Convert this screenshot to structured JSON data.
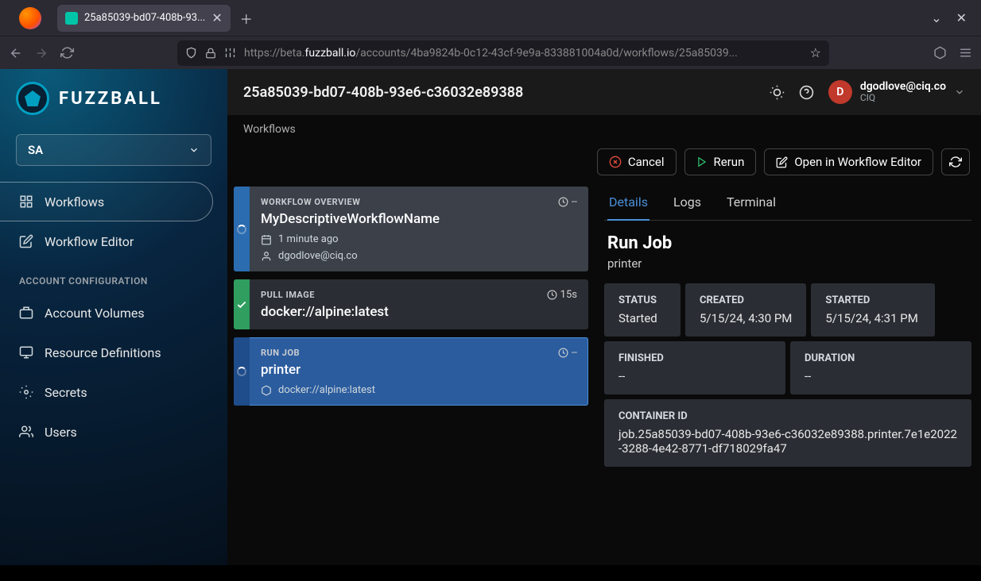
{
  "browser": {
    "tab_title": "25a85039-bd07-408b-93...",
    "url_prefix": "https://beta.",
    "url_host": "fuzzball.io",
    "url_path": "/accounts/4ba9824b-0c12-43cf-9e9a-833881004a0d/workflows/25a85039..."
  },
  "logo": {
    "text": "FUZZBALL"
  },
  "org_selector": {
    "value": "SA"
  },
  "sidebar": {
    "workflows": "Workflows",
    "workflow_editor": "Workflow Editor",
    "section": "ACCOUNT CONFIGURATION",
    "account_volumes": "Account Volumes",
    "resource_definitions": "Resource Definitions",
    "secrets": "Secrets",
    "users": "Users"
  },
  "topbar": {
    "title": "25a85039-bd07-408b-93e6-c36032e89388",
    "avatar_initial": "D",
    "user_email": "dgodlove@ciq.co",
    "user_org": "CIQ"
  },
  "breadcrumb": "Workflows",
  "actions": {
    "cancel": "Cancel",
    "rerun": "Rerun",
    "open_editor": "Open in Workflow Editor"
  },
  "steps": {
    "overview": {
      "label": "WORKFLOW OVERVIEW",
      "name": "MyDescriptiveWorkflowName",
      "time": "--",
      "ago": "1 minute ago",
      "user": "dgodlove@ciq.co"
    },
    "pull": {
      "label": "PULL IMAGE",
      "name": "docker://alpine:latest",
      "time": "15s"
    },
    "run": {
      "label": "RUN JOB",
      "name": "printer",
      "time": "--",
      "image": "docker://alpine:latest"
    }
  },
  "tabs": {
    "details": "Details",
    "logs": "Logs",
    "terminal": "Terminal"
  },
  "detail": {
    "title": "Run Job",
    "subtitle": "printer",
    "status_label": "STATUS",
    "status_value": "Started",
    "created_label": "CREATED",
    "created_value": "5/15/24, 4:30 PM",
    "started_label": "STARTED",
    "started_value": "5/15/24, 4:31 PM",
    "finished_label": "FINISHED",
    "finished_value": "--",
    "duration_label": "DURATION",
    "duration_value": "--",
    "container_label": "CONTAINER ID",
    "container_value": "job.25a85039-bd07-408b-93e6-c36032e89388.printer.7e1e2022-3288-4e42-8771-df718029fa47"
  }
}
